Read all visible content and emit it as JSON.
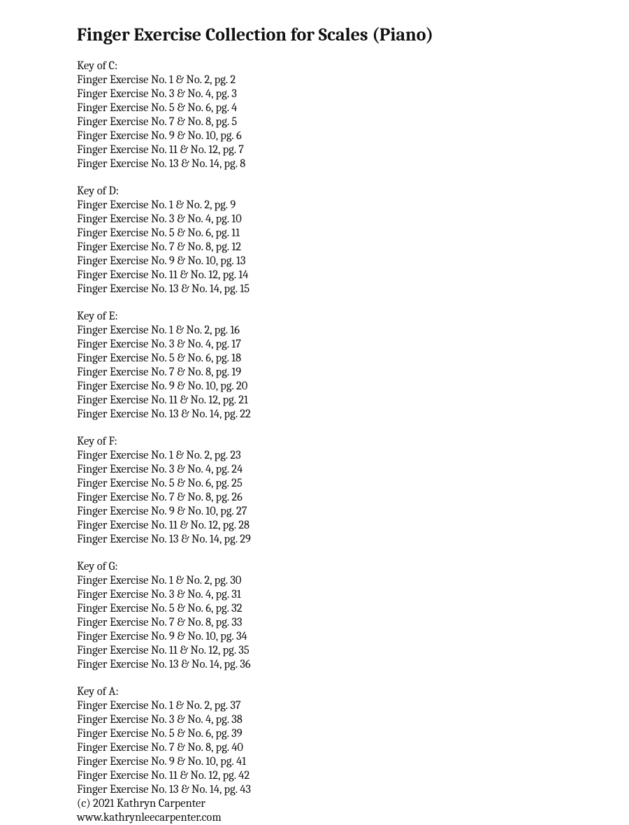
{
  "title": "Finger Exercise Collection for Scales (Piano)",
  "sections": [
    {
      "heading": "Key of C:",
      "entries": [
        "Finger Exercise No. 1 & No. 2, pg. 2",
        "Finger Exercise No. 3 & No. 4, pg. 3",
        "Finger Exercise No. 5 & No. 6, pg. 4",
        "Finger Exercise No. 7 & No. 8, pg. 5",
        "Finger Exercise No. 9 & No. 10, pg. 6",
        "Finger Exercise No. 11 & No. 12, pg. 7",
        "Finger Exercise No. 13 & No. 14, pg. 8"
      ]
    },
    {
      "heading": "Key of D:",
      "entries": [
        "Finger Exercise No. 1 & No. 2, pg. 9",
        "Finger Exercise No. 3 & No. 4, pg. 10",
        "Finger Exercise No. 5 & No. 6, pg. 11",
        "Finger Exercise No. 7 & No. 8, pg. 12",
        "Finger Exercise No. 9 & No. 10, pg. 13",
        "Finger Exercise No. 11 & No. 12, pg. 14",
        "Finger Exercise No. 13 & No. 14, pg. 15"
      ]
    },
    {
      "heading": "Key of E:",
      "entries": [
        "Finger Exercise No. 1 & No. 2, pg. 16",
        "Finger Exercise No. 3 & No. 4, pg. 17",
        "Finger Exercise No. 5 & No. 6, pg. 18",
        "Finger Exercise No. 7 & No. 8, pg. 19",
        "Finger Exercise No. 9 & No. 10, pg. 20",
        "Finger Exercise No. 11 & No. 12, pg. 21",
        "Finger Exercise No. 13 & No. 14, pg. 22"
      ]
    },
    {
      "heading": "Key of F:",
      "entries": [
        "Finger Exercise No. 1 & No. 2, pg. 23",
        "Finger Exercise No. 3 & No. 4, pg. 24",
        "Finger Exercise No. 5 & No. 6, pg. 25",
        "Finger Exercise No. 7 & No. 8, pg. 26",
        "Finger Exercise No. 9 & No. 10, pg. 27",
        "Finger Exercise No. 11 & No. 12, pg. 28",
        "Finger Exercise No. 13 & No. 14, pg. 29"
      ]
    },
    {
      "heading": "Key of G:",
      "entries": [
        "Finger Exercise No. 1 & No. 2, pg. 30",
        "Finger Exercise No. 3 & No. 4, pg. 31",
        "Finger Exercise No. 5 & No. 6, pg. 32",
        "Finger Exercise No. 7 & No. 8, pg. 33",
        "Finger Exercise No. 9 & No. 10, pg. 34",
        "Finger Exercise No. 11 & No. 12, pg. 35",
        "Finger Exercise No. 13 & No. 14, pg. 36"
      ]
    },
    {
      "heading": "Key of A:",
      "entries": [
        "Finger Exercise No. 1 & No. 2, pg. 37",
        "Finger Exercise No. 3 & No. 4, pg. 38",
        "Finger Exercise No. 5 & No. 6, pg. 39",
        "Finger Exercise No. 7 & No. 8, pg. 40",
        "Finger Exercise No. 9 & No. 10, pg. 41",
        "Finger Exercise No. 11 & No. 12, pg. 42",
        "Finger Exercise No. 13 & No. 14, pg. 43"
      ]
    }
  ],
  "footer": {
    "copyright": "(c) 2021 Kathryn Carpenter",
    "website": "www.kathrynleecarpenter.com"
  }
}
